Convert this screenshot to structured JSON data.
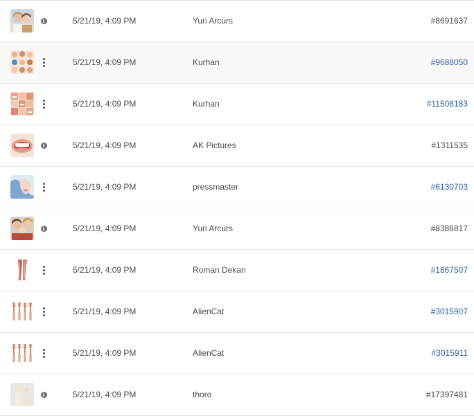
{
  "rows": [
    {
      "thumbnail": "family-photo",
      "action_icon": "info-icon",
      "date": "5/21/19, 4:09 PM",
      "author": "Yuri Arcurs",
      "asset_id": "#8691637",
      "id_is_link": false
    },
    {
      "thumbnail": "collage-photo",
      "action_icon": "more-vertical-icon",
      "date": "5/21/19, 4:09 PM",
      "author": "Kurhan",
      "asset_id": "#9688050",
      "id_is_link": true
    },
    {
      "thumbnail": "faces-grid-photo",
      "action_icon": "more-vertical-icon",
      "date": "5/21/19, 4:09 PM",
      "author": "Kurhan",
      "asset_id": "#11506183",
      "id_is_link": true
    },
    {
      "thumbnail": "smile-teeth-photo",
      "action_icon": "info-icon",
      "date": "5/21/19, 4:09 PM",
      "author": "AK Pictures",
      "asset_id": "#1311535",
      "id_is_link": false
    },
    {
      "thumbnail": "face-closeup-photo",
      "action_icon": "more-vertical-icon",
      "date": "5/21/19, 4:09 PM",
      "author": "pressmaster",
      "asset_id": "#6130703",
      "id_is_link": true
    },
    {
      "thumbnail": "family-photo",
      "action_icon": "info-icon",
      "date": "5/21/19, 4:09 PM",
      "author": "Yuri Arcurs",
      "asset_id": "#8386817",
      "id_is_link": false
    },
    {
      "thumbnail": "anatomy-legs-illustration",
      "action_icon": "more-vertical-icon",
      "date": "5/21/19, 4:09 PM",
      "author": "Roman Dekan",
      "asset_id": "#1867507",
      "id_is_link": true
    },
    {
      "thumbnail": "anatomy-figures-illustration",
      "action_icon": "more-vertical-icon",
      "date": "5/21/19, 4:09 PM",
      "author": "AlienCat",
      "asset_id": "#3015907",
      "id_is_link": true
    },
    {
      "thumbnail": "anatomy-figures-illustration",
      "action_icon": "more-vertical-icon",
      "date": "5/21/19, 4:09 PM",
      "author": "AlienCat",
      "asset_id": "#3015911",
      "id_is_link": true
    },
    {
      "thumbnail": "mannequin-photo",
      "action_icon": "info-icon",
      "date": "5/21/19, 4:09 PM",
      "author": "thoro",
      "asset_id": "#17397481",
      "id_is_link": false
    }
  ],
  "colors": {
    "text": "#4b4b4b",
    "link": "#2d5f9e",
    "divider": "#e3e3e3",
    "row_alt_background": "#f9f9f9"
  }
}
